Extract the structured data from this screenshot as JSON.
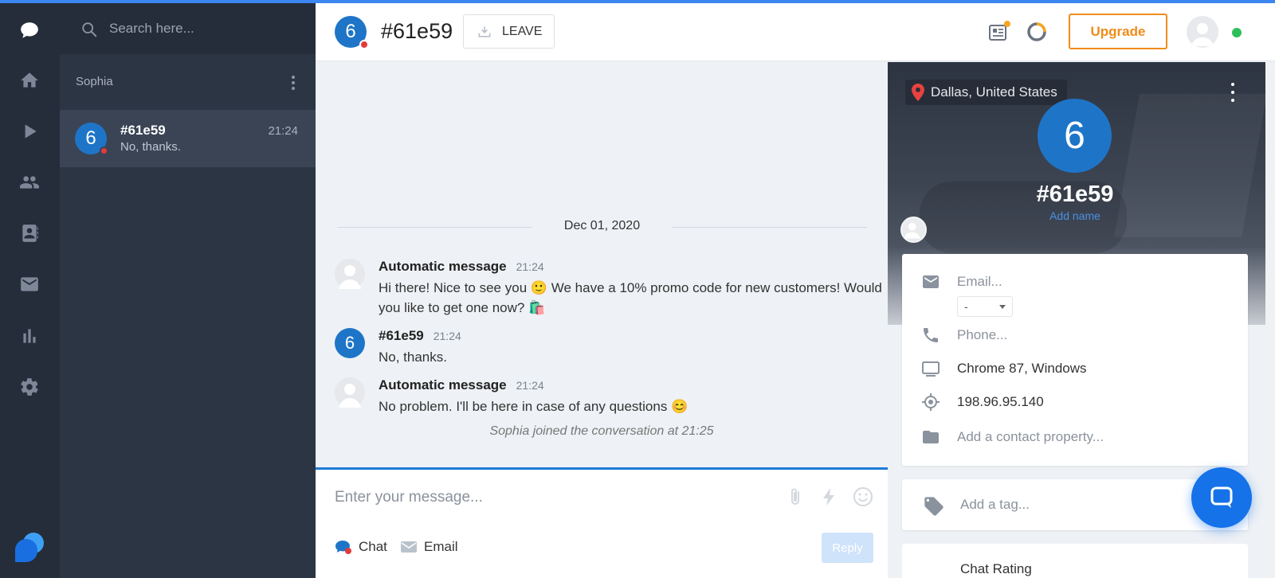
{
  "search": {
    "placeholder": "Search here..."
  },
  "sidebar": {
    "agent_name": "Sophia",
    "conversations": [
      {
        "avatar_letter": "6",
        "name": "#61e59",
        "last_message": "No, thanks.",
        "time": "21:24"
      }
    ]
  },
  "header": {
    "avatar_letter": "6",
    "title": "#61e59",
    "leave_label": "LEAVE",
    "upgrade_label": "Upgrade"
  },
  "chat": {
    "date_separator": "Dec 01, 2020",
    "messages": [
      {
        "author": "Automatic message",
        "time": "21:24",
        "text": "Hi there! Nice to see you 🙂 We have a 10% promo code for new customers! Would you like to get one now? 🛍️"
      },
      {
        "author": "#61e59",
        "avatar_letter": "6",
        "time": "21:24",
        "text": "No, thanks."
      },
      {
        "author": "Automatic message",
        "time": "21:24",
        "text": "No problem. I'll be here in case of any questions 😊"
      }
    ],
    "system_note": "Sophia joined the conversation at 21:25"
  },
  "composer": {
    "placeholder": "Enter your message...",
    "tab_chat": "Chat",
    "tab_email": "Email",
    "reply_label": "Reply"
  },
  "visitor": {
    "location": "Dallas, United States",
    "avatar_letter": "6",
    "name": "#61e59",
    "add_name_label": "Add name",
    "email_placeholder": "Email...",
    "country_code": "-",
    "phone_placeholder": "Phone...",
    "browser": "Chrome 87, Windows",
    "ip": "198.96.95.140",
    "add_property_label": "Add a contact property...",
    "add_tag_label": "Add a tag...",
    "rating_label": "Chat Rating"
  },
  "icons": {
    "rail": [
      "chat-icon",
      "home-icon",
      "play-icon",
      "contacts-icon",
      "address-book-icon",
      "inbox-icon",
      "analytics-icon",
      "settings-icon"
    ],
    "header": [
      "news-icon",
      "loading-ring-icon"
    ]
  },
  "colors": {
    "accent": "#1e75c8",
    "upgrade": "#f08b1a",
    "online": "#2fbf5a",
    "offline": "#e23b3b",
    "sidebar_dark": "#252d3a"
  }
}
